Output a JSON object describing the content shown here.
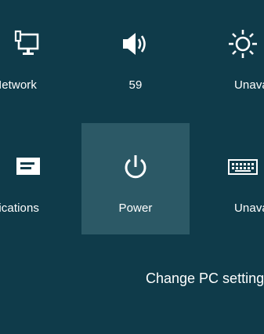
{
  "colors": {
    "background": "#0f3b4a",
    "selected_tile": "#2c5966",
    "foreground": "#ffffff"
  },
  "tiles": [
    {
      "icon": "network-icon",
      "label": "Network"
    },
    {
      "icon": "volume-icon",
      "label": "59"
    },
    {
      "icon": "brightness-icon",
      "label": "Unavailable"
    },
    {
      "icon": "notifications-icon",
      "label": "Notifications"
    },
    {
      "icon": "power-icon",
      "label": "Power"
    },
    {
      "icon": "keyboard-icon",
      "label": "Unavailable"
    }
  ],
  "change_pc_settings": "Change PC settings"
}
